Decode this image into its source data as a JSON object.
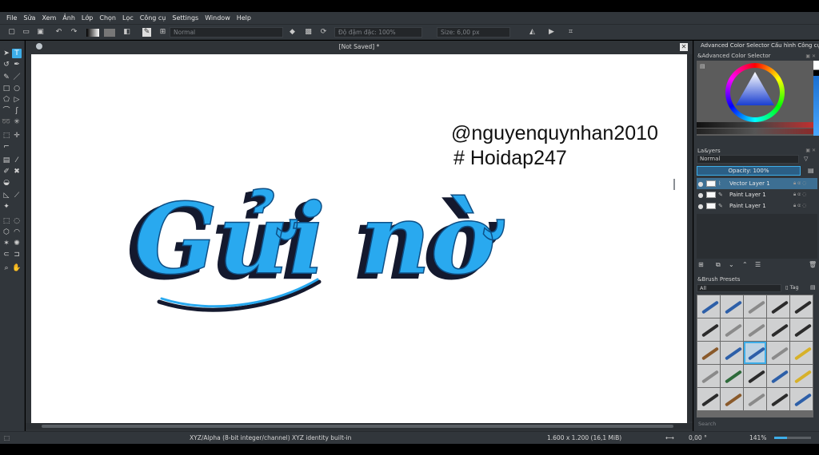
{
  "menu": [
    "File",
    "Sửa",
    "Xem",
    "Ảnh",
    "Lớp",
    "Chọn",
    "Lọc",
    "Công cụ",
    "Settings",
    "Window",
    "Help"
  ],
  "toolbar": {
    "blend_mode": "Normal",
    "opacity": "Độ đậm đặc: 100%",
    "size": "Size: 6,00 px"
  },
  "document": {
    "title": "[Not Saved]  *",
    "close": "✕",
    "handle": "@nguyenquynhan2010",
    "hashtag": "# Hoidap247",
    "lettering": "Gửi nờ"
  },
  "dock": {
    "tab_color": "Advanced Color Selector",
    "tab_tool": "Cấu hình Công cụ",
    "color_panel_title": "&Advanced Color Selector",
    "layers_title": "La&yers",
    "layers_blend": "Normal",
    "layers_opacity": "Opacity:  100%",
    "layers": [
      {
        "name": "Vector Layer 1",
        "selected": true
      },
      {
        "name": "Paint Layer 1",
        "selected": false
      },
      {
        "name": "Paint Layer 1",
        "selected": false
      }
    ],
    "presets_title": "&Brush Presets",
    "presets_filter": "All",
    "presets_tag": "Tag",
    "search_placeholder": "Search"
  },
  "status": {
    "color_space": "XYZ/Alpha (8-bit integer/channel)  XYZ identity built-in",
    "dimensions": "1.600 x 1.200 (16,1 MiB)",
    "rotation": "0,00 °",
    "zoom": "141%"
  },
  "colors": {
    "accent": "#3daee9",
    "panel": "#31363b",
    "lettering_fill": "#29a9ef",
    "lettering_shadow": "#14192e"
  }
}
